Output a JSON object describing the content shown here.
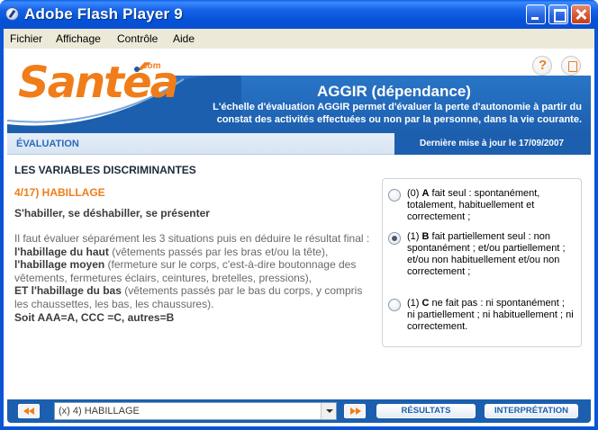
{
  "window": {
    "title": "Adobe Flash Player 9"
  },
  "menu": {
    "items": [
      "Fichier",
      "Affichage",
      "Contrôle",
      "Aide"
    ]
  },
  "header": {
    "logo_text": "Santéa",
    "logo_suffix": "com",
    "title": "AGGIR (dépendance)",
    "description": "L'échelle d'évaluation AGGIR  permet d'évaluer la perte d'autonomie à partir du constat des activités effectuées ou non par la personne, dans la vie courante.",
    "section_label": "ÉVALUATION",
    "last_update": "Dernière mise à jour le 17/09/2007",
    "icons": [
      "help-icon",
      "document-icon"
    ]
  },
  "main": {
    "section_title": "LES VARIABLES DISCRIMINANTES",
    "item_title": "4/17) HABILLAGE",
    "item_subtitle": "S'habiller, se déshabiller, se présenter",
    "intro": "Il faut évaluer séparément les 3 situations puis en déduire le résultat final :",
    "haut_label": "l'habillage du haut",
    "haut_text": " (vêtements passés par les bras et/ou la tête),",
    "moyen_label": "l'habillage moyen",
    "moyen_text": " (fermeture sur le corps, c'est-à-dire boutonnage des vêtements, fermetures éclairs, ceintures, bretelles, pressions),",
    "bas_label": "ET l'habillage du bas",
    "bas_text": " (vêtements passés par le bas du corps, y compris les chaussettes, les bas, les chaussures).",
    "soit": "Soit AAA=A,  CCC =C,  autres=B"
  },
  "options": [
    {
      "prefix": "(0) ",
      "code": "A",
      "text": " fait seul : spontanément, totalement, habituellement et correctement ;",
      "selected": false
    },
    {
      "prefix": "(1) ",
      "code": "B",
      "text": " fait partiellement seul : non spontanément ; et/ou partiellement ; et/ou non habituellement et/ou non correctement ;",
      "selected": true
    },
    {
      "prefix": "(1) ",
      "code": "C",
      "text": " ne fait pas : ni spontanément ; ni partiellement ; ni habituellement ; ni correctement.",
      "selected": false
    }
  ],
  "footer": {
    "select_value": "(x) 4) HABILLAGE",
    "results_label": "RÉSULTATS",
    "interpretation_label": "INTERPRÉTATION"
  },
  "colors": {
    "brand_orange": "#f07d1a",
    "brand_blue": "#1c5fae",
    "titlebar_blue": "#0a55d6"
  }
}
